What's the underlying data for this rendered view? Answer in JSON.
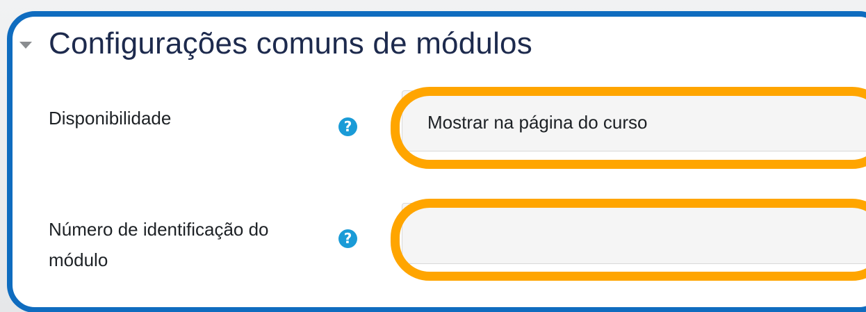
{
  "section": {
    "title": "Configurações comuns de módulos",
    "collapse_icon": "caret-down-icon"
  },
  "fields": [
    {
      "label": "Disponibilidade",
      "help_icon": "question-circle-icon",
      "help_glyph": "?",
      "value": "Mostrar na página do curso"
    },
    {
      "label": "Número de identificação do módulo",
      "help_icon": "question-circle-icon",
      "help_glyph": "?",
      "value": ""
    }
  ],
  "colors": {
    "panel_border": "#0f6cbf",
    "highlight": "#ffa500",
    "help_icon": "#1a9bd7",
    "title": "#1d2a4d"
  }
}
